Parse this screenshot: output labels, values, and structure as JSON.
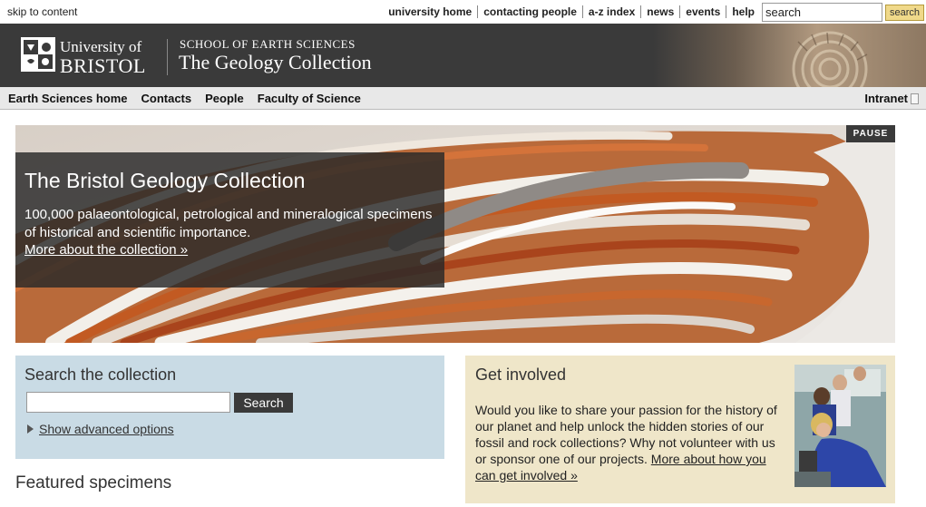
{
  "topbar": {
    "skip_link": "skip to content",
    "links": [
      "university home",
      "contacting people",
      "a-z index",
      "news",
      "events",
      "help"
    ],
    "search_value": "search",
    "search_button": "search"
  },
  "header": {
    "university_line1": "University of",
    "university_line2": "BRISTOL",
    "school": "SCHOOL OF EARTH SCIENCES",
    "site_title": "The Geology Collection"
  },
  "nav": {
    "items": [
      "Earth Sciences home",
      "Contacts",
      "People",
      "Faculty of Science"
    ],
    "intranet": "Intranet"
  },
  "hero": {
    "pause_label": "PAUSE",
    "title": "The Bristol Geology Collection",
    "text": "100,000 palaeontological, petrological and mineralogical specimens of historical and scientific importance.",
    "link": "More about the collection »"
  },
  "search_panel": {
    "title": "Search the collection",
    "button": "Search",
    "advanced": "Show advanced options"
  },
  "featured": {
    "title": "Featured specimens"
  },
  "involved": {
    "title": "Get involved",
    "text": "Would you like to share your passion for the history of our planet and help unlock the hidden stories of our fossil and rock collections? Why not volunteer with us or sponsor one of our projects. ",
    "link": "More about how you can get involved »"
  },
  "colors": {
    "header_bg": "#3a3a3a",
    "nav_bg": "#e8e8e8",
    "search_panel_bg": "#c9dbe5",
    "involved_bg": "#efe6c9",
    "search_button_bg": "#f0d98a"
  }
}
